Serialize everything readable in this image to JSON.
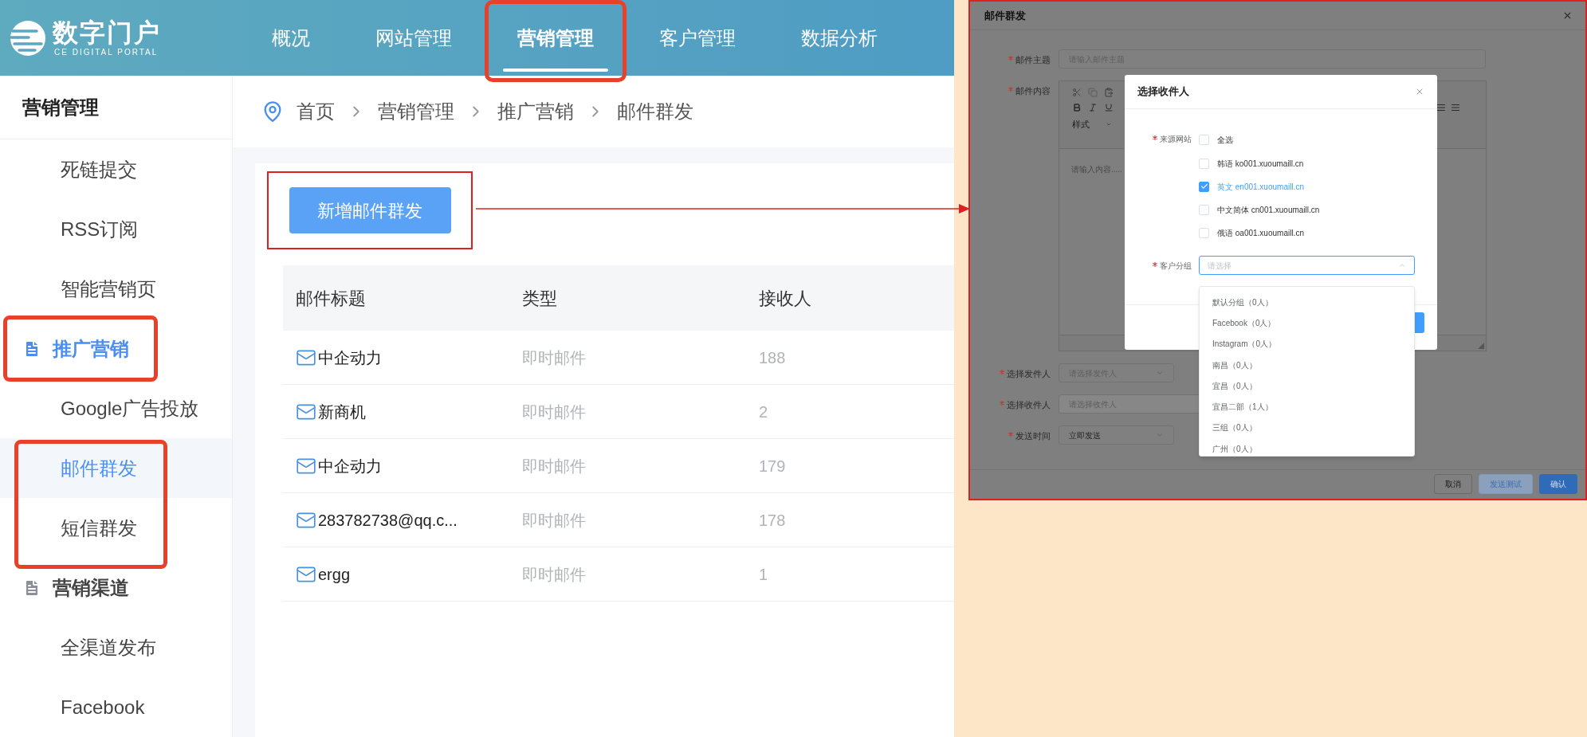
{
  "header": {
    "logo": {
      "name": "数字门户",
      "tagline": "CE DIGITAL PORTAL"
    },
    "nav": [
      {
        "label": "概况",
        "selected": false,
        "highlighted": false
      },
      {
        "label": "网站管理",
        "selected": false,
        "highlighted": false
      },
      {
        "label": "营销管理",
        "selected": true,
        "highlighted": true
      },
      {
        "label": "客户管理",
        "selected": false,
        "highlighted": false
      },
      {
        "label": "数据分析",
        "selected": false,
        "highlighted": false
      }
    ]
  },
  "sidebar": {
    "title": "营销管理",
    "items": [
      {
        "label": "死链提交",
        "kind": "link",
        "selected": false,
        "highlighted": false
      },
      {
        "label": "RSS订阅",
        "kind": "link",
        "selected": false,
        "highlighted": false
      },
      {
        "label": "智能营销页",
        "kind": "link",
        "selected": false,
        "highlighted": false
      },
      {
        "label": "推广营销",
        "kind": "group",
        "selected": true,
        "highlighted": true
      },
      {
        "label": "Google广告投放",
        "kind": "link",
        "selected": false,
        "highlighted": false
      },
      {
        "label": "邮件群发",
        "kind": "link",
        "selected": true,
        "highlighted": true
      },
      {
        "label": "短信群发",
        "kind": "link",
        "selected": false,
        "highlighted": true
      },
      {
        "label": "营销渠道",
        "kind": "group",
        "selected": false,
        "highlighted": false
      },
      {
        "label": "全渠道发布",
        "kind": "link",
        "selected": false,
        "highlighted": false
      },
      {
        "label": "Facebook",
        "kind": "link",
        "selected": false,
        "highlighted": false
      }
    ]
  },
  "breadcrumb": [
    "首页",
    "营销管理",
    "推广营销",
    "邮件群发"
  ],
  "add_button": {
    "label": "新增邮件群发",
    "highlighted": true
  },
  "table": {
    "columns": [
      "邮件标题",
      "类型",
      "接收人"
    ],
    "rows": [
      {
        "title": "中企动力",
        "type": "即时邮件",
        "recipients": "188"
      },
      {
        "title": "新商机",
        "type": "即时邮件",
        "recipients": "2"
      },
      {
        "title": "中企动力",
        "type": "即时邮件",
        "recipients": "179"
      },
      {
        "title": "283782738@qq.c...",
        "type": "即时邮件",
        "recipients": "178"
      },
      {
        "title": "ergg",
        "type": "即时邮件",
        "recipients": "1"
      }
    ]
  },
  "dialog": {
    "title": "邮件群发",
    "style_label": "样式",
    "fields": [
      {
        "label": "邮件主题",
        "required": true,
        "kind": "text",
        "placeholder": "请输入邮件主题"
      },
      {
        "label": "邮件内容",
        "required": true,
        "kind": "editor",
        "placeholder": "请输入内容....."
      },
      {
        "label": "选择发件人",
        "required": true,
        "kind": "select",
        "placeholder": "请选择发件人"
      },
      {
        "label": "选择收件人",
        "required": true,
        "kind": "disabled",
        "placeholder": "请选择收件人"
      },
      {
        "label": "发送时间",
        "required": true,
        "kind": "select",
        "value": "立即发送"
      }
    ],
    "buttons": [
      {
        "label": "取消",
        "kind": "default"
      },
      {
        "label": "发送测试",
        "kind": "plain"
      },
      {
        "label": "确认",
        "kind": "primary"
      }
    ]
  },
  "recipient_modal": {
    "title": "选择收件人",
    "source_label": "来源网站",
    "select_all": {
      "label": "全选",
      "checked": false
    },
    "sites": [
      {
        "label": "韩语 ko001.xuoumaill.cn",
        "checked": false
      },
      {
        "label": "英文 en001.xuoumaill.cn",
        "checked": true
      },
      {
        "label": "中文简体 cn001.xuoumaill.cn",
        "checked": false
      },
      {
        "label": "俄语 oa001.xuoumaill.cn",
        "checked": false
      }
    ],
    "group_label": "客户分组",
    "group_placeholder": "请选择",
    "group_options": [
      "默认分组（0人）",
      "Facebook（0人）",
      "Instagram（0人）",
      "南昌（0人）",
      "宜昌（0人）",
      "宜昌二部（1人）",
      "三组（0人）",
      "广州（0人）"
    ]
  }
}
